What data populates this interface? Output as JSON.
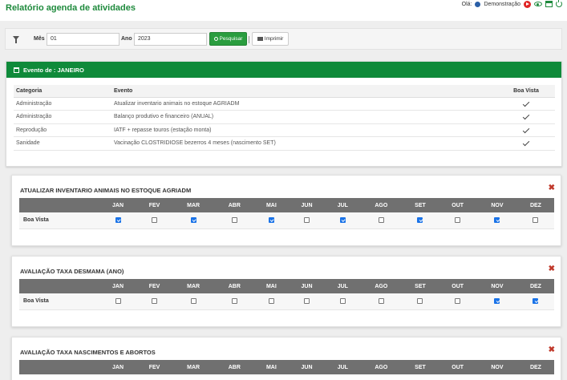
{
  "header": {
    "title": "Relatório agenda de atividades",
    "greeting": "Olá:",
    "user": "Demonstração"
  },
  "filter": {
    "month_label": "Mês",
    "month_value": "01",
    "year_label": "Ano",
    "year_value": "2023",
    "search_label": "Pesquisar",
    "print_label": "Imprimir"
  },
  "event_panel": {
    "title": "Evento de : JANEIRO",
    "columns": [
      "Categoria",
      "Evento",
      "Boa Vista"
    ],
    "rows": [
      {
        "categoria": "Administração",
        "evento": "Atualizar inventario animais no estoque AGRIADM"
      },
      {
        "categoria": "Administração",
        "evento": "Balanço produtivo e financeiro (ANUAL)"
      },
      {
        "categoria": "Reprodução",
        "evento": "IATF + repasse touros (estação monta)"
      },
      {
        "categoria": "Sanidade",
        "evento": "Vacinação CLOSTRIDIOSE bezerros 4 meses (nascimento SET)"
      }
    ]
  },
  "months": [
    "JAN",
    "FEV",
    "MAR",
    "ABR",
    "MAI",
    "JUN",
    "JUL",
    "AGO",
    "SET",
    "OUT",
    "NOV",
    "DEZ"
  ],
  "activities": [
    {
      "title": "ATUALIZAR INVENTARIO ANIMAIS NO ESTOQUE AGRIADM",
      "rows": [
        {
          "label": "Boa Vista",
          "checked": [
            true,
            false,
            true,
            false,
            true,
            false,
            true,
            false,
            true,
            false,
            true,
            false
          ]
        }
      ]
    },
    {
      "title": "AVALIAÇÃO TAXA DESMAMA (ANO)",
      "rows": [
        {
          "label": "Boa Vista",
          "checked": [
            false,
            false,
            false,
            false,
            false,
            false,
            false,
            false,
            false,
            false,
            true,
            true
          ]
        }
      ]
    },
    {
      "title": "AVALIAÇÃO TAXA NASCIMENTOS E ABORTOS",
      "rows": []
    }
  ],
  "colors": {
    "brand_green": "#1e8a3c",
    "panel_green": "#0f8a3a",
    "checkbox_blue": "#1a73e8",
    "close_red": "#c0392b"
  }
}
